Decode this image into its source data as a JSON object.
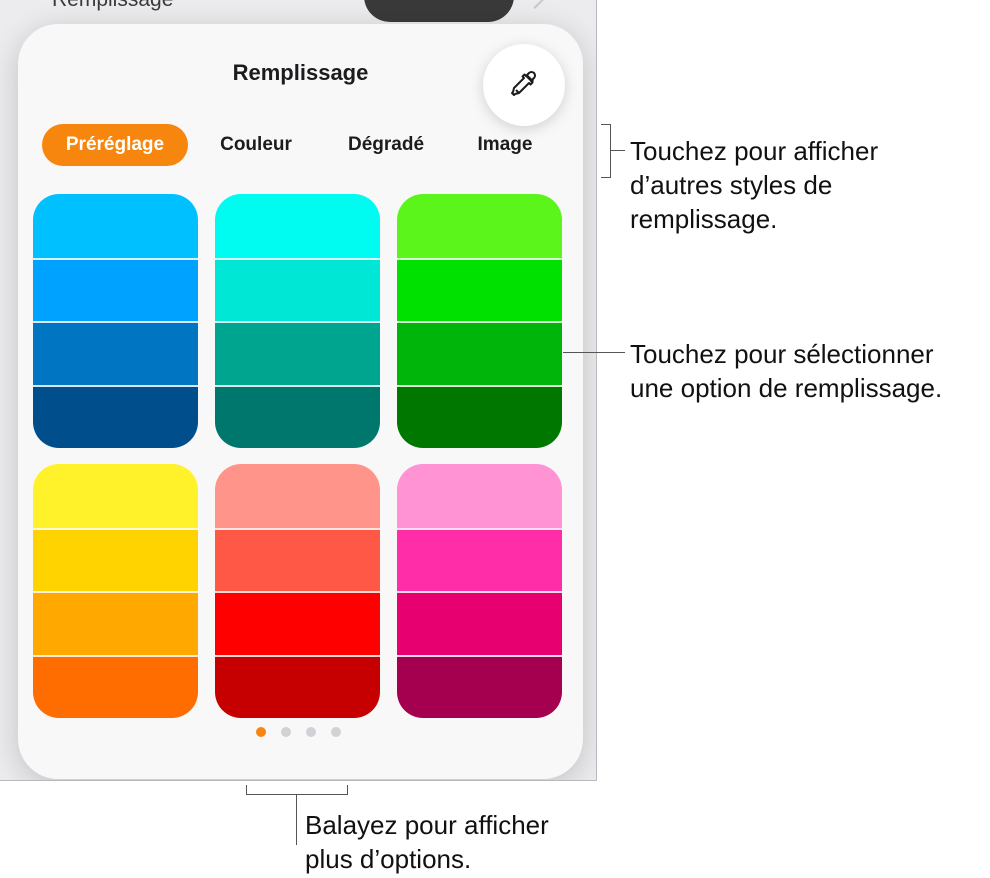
{
  "background_screen": {
    "row_label": "Remplissage"
  },
  "panel": {
    "title": "Remplissage",
    "tabs": [
      {
        "label": "Préréglage",
        "selected": true
      },
      {
        "label": "Couleur",
        "selected": false
      },
      {
        "label": "Dégradé",
        "selected": false
      },
      {
        "label": "Image",
        "selected": false
      }
    ],
    "swatches": [
      {
        "colors": [
          "#00c0ff",
          "#00a2ff",
          "#0076c2",
          "#004f8c"
        ]
      },
      {
        "colors": [
          "#00fbf0",
          "#00e7d5",
          "#00a58f",
          "#00776c"
        ]
      },
      {
        "colors": [
          "#5cf51b",
          "#00e100",
          "#00b50a",
          "#007800"
        ]
      },
      {
        "colors": [
          "#fff22a",
          "#ffd300",
          "#ffa800",
          "#ff6d00"
        ]
      },
      {
        "colors": [
          "#ff958a",
          "#ff5846",
          "#ff0000",
          "#c60000"
        ]
      },
      {
        "colors": [
          "#ff93d3",
          "#ff2da8",
          "#e7006f",
          "#a5004f"
        ]
      }
    ],
    "page_indicator": {
      "count": 4,
      "active": 0
    }
  },
  "colors": {
    "accent": "#f7860f"
  },
  "icons": {
    "eyedropper": "eyedropper-icon"
  },
  "callouts": {
    "tabs": "Touchez pour afficher\nd’autres styles de\nremplissage.",
    "swatches": "Touchez pour sélectionner\nune option de remplissage.",
    "swipe": "Balayez pour afficher\nplus d’options."
  }
}
